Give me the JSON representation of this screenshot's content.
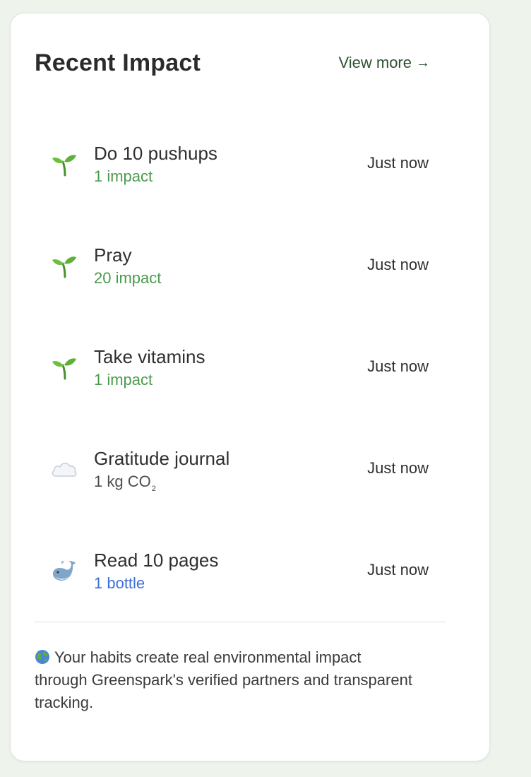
{
  "card": {
    "title": "Recent Impact",
    "view_more_label": "View more",
    "view_more_arrow": "→"
  },
  "items": [
    {
      "title": "Do 10 pushups",
      "impact": "1 impact",
      "time": "Just now",
      "icon": "seedling-icon",
      "impact_color": "#4c9a4f"
    },
    {
      "title": "Pray",
      "impact": "20 impact",
      "time": "Just now",
      "icon": "seedling-icon",
      "impact_color": "#4c9a4f"
    },
    {
      "title": "Take vitamins",
      "impact": "1 impact",
      "time": "Just now",
      "icon": "seedling-icon",
      "impact_color": "#4c9a4f"
    },
    {
      "title": "Gratitude journal",
      "impact_main": "1 kg CO",
      "impact_subscript": "2",
      "time": "Just now",
      "icon": "cloud-icon",
      "impact_color": "#4d4d4d"
    },
    {
      "title": "Read 10 pages",
      "impact": "1 bottle",
      "time": "Just now",
      "icon": "whale-icon",
      "impact_color": "#3f6fd8"
    }
  ],
  "footer": {
    "icon": "globe-icon",
    "text": "Your habits create real environmental impact through Greenspark's verified partners and transparent tracking."
  }
}
